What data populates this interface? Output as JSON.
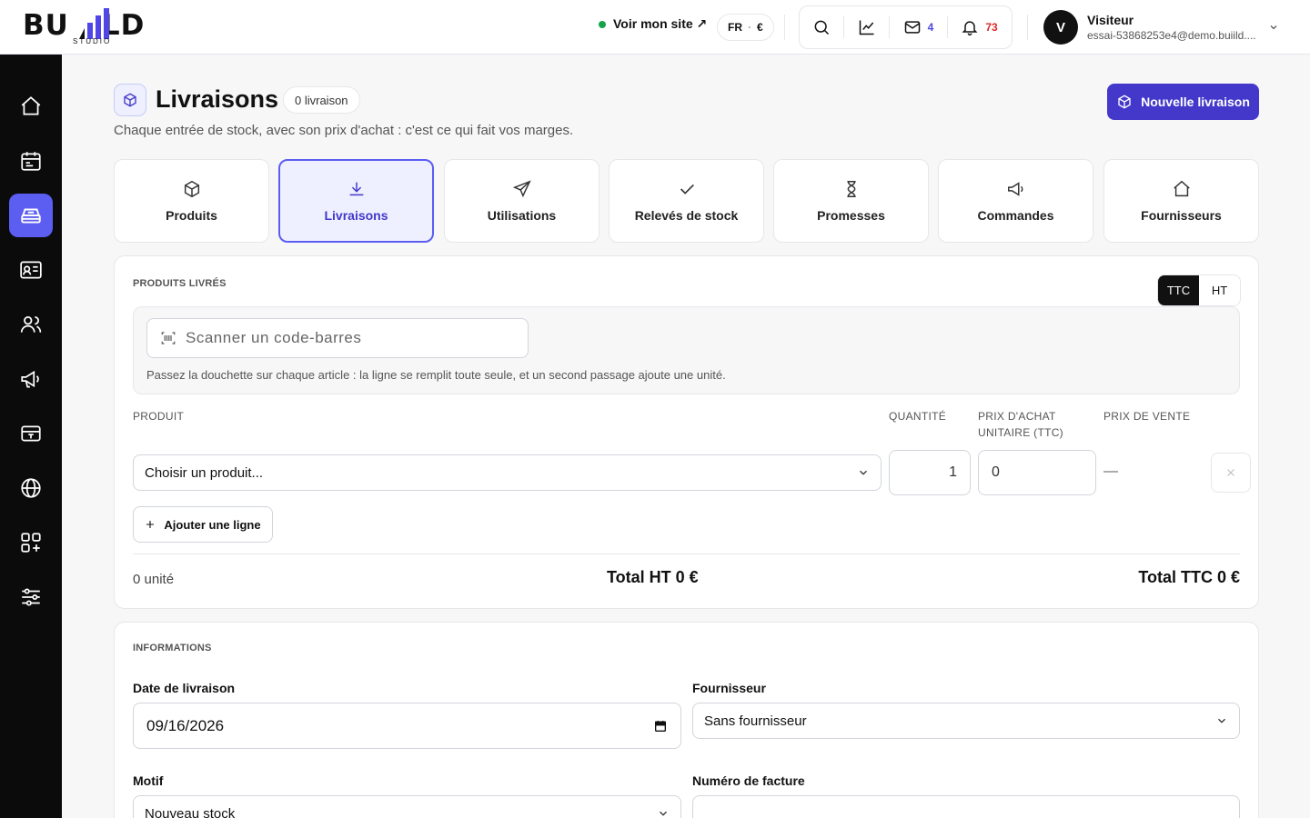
{
  "brand": {
    "name_left": "BU",
    "name_right": "LD",
    "sub": "STUDIO"
  },
  "header": {
    "site_link": "Voir mon site ↗",
    "lang": "FR",
    "currency": "€",
    "mail_count": "4",
    "notif_count": "73",
    "user": {
      "initial": "V",
      "name": "Visiteur",
      "email": "essai-53868253e4@demo.buiild...."
    }
  },
  "sidebar": {
    "items": [
      {
        "icon": "home-icon"
      },
      {
        "icon": "calendar-icon"
      },
      {
        "icon": "stock-icon",
        "active": true
      },
      {
        "icon": "id-card-icon"
      },
      {
        "icon": "users-icon"
      },
      {
        "icon": "megaphone-icon"
      },
      {
        "icon": "register-icon"
      },
      {
        "icon": "globe-icon"
      },
      {
        "icon": "apps-icon"
      },
      {
        "icon": "sliders-icon"
      }
    ]
  },
  "page": {
    "title": "Livraisons",
    "count_badge": "0 livraison",
    "subtitle": "Chaque entrée de stock, avec son prix d'achat : c'est ce qui fait vos marges.",
    "new_button": "Nouvelle livraison"
  },
  "tabs": [
    {
      "label": "Produits",
      "icon": "box-icon"
    },
    {
      "label": "Livraisons",
      "icon": "download-icon",
      "active": true
    },
    {
      "label": "Utilisations",
      "icon": "send-icon"
    },
    {
      "label": "Relevés de stock",
      "icon": "check-icon"
    },
    {
      "label": "Promesses",
      "icon": "hourglass-icon"
    },
    {
      "label": "Commandes",
      "icon": "megaphone-icon"
    },
    {
      "label": "Fournisseurs",
      "icon": "home-icon"
    }
  ],
  "products": {
    "section_label": "PRODUITS LIVRÉS",
    "toggle": {
      "ttc": "TTC",
      "ht": "HT",
      "selected": "TTC"
    },
    "scan_placeholder": "Scanner un code-barres",
    "scan_hint": "Passez la douchette sur chaque article : la ligne se remplit toute seule, et un second passage ajoute une unité.",
    "columns": {
      "product": "PRODUIT",
      "quantity": "QUANTITÉ",
      "price_line1": "PRIX D'ACHAT",
      "price_line2": "UNITAIRE (TTC)",
      "sale": "PRIX DE VENTE"
    },
    "row": {
      "product_placeholder": "Choisir un produit...",
      "quantity": "1",
      "price": "0",
      "sale": "—"
    },
    "add_line": "Ajouter une ligne",
    "units": "0 unité",
    "total_ht": "Total HT 0 €",
    "total_ttc": "Total TTC 0 €"
  },
  "info": {
    "section_label": "INFORMATIONS",
    "date_label": "Date de livraison",
    "date_value": "09/16/2026",
    "supplier_label": "Fournisseur",
    "supplier_value": "Sans fournisseur",
    "reason_label": "Motif",
    "reason_value": "Nouveau stock",
    "invoice_label": "Numéro de facture",
    "invoice_value": ""
  },
  "colors": {
    "accent": "#4338ca",
    "accent_light": "#5b5ef0",
    "status_online": "#16a34a",
    "notif": "#dc2626"
  }
}
